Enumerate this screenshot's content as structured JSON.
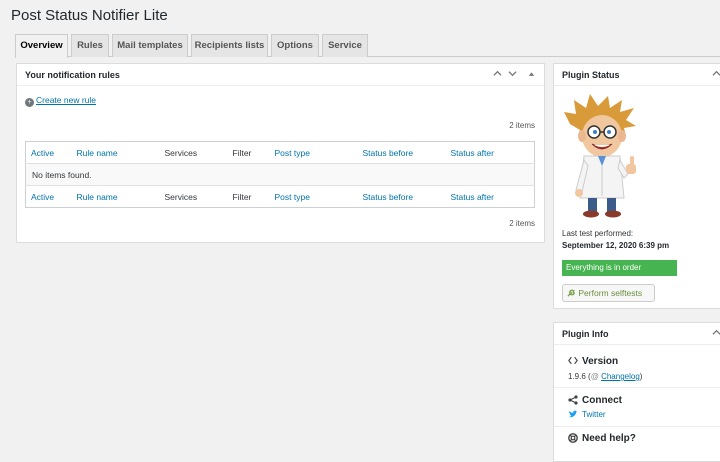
{
  "page": {
    "title": "Post Status Notifier Lite"
  },
  "tabs": [
    "Overview",
    "Rules",
    "Mail templates",
    "Recipients lists",
    "Options",
    "Service"
  ],
  "rules_box": {
    "title": "Your notification rules",
    "create_link": "Create new rule",
    "item_count": "2 items",
    "columns": [
      "Active",
      "Rule name",
      "Services",
      "Filter",
      "Post type",
      "Status before",
      "Status after"
    ],
    "empty_message": "No items found."
  },
  "status_box": {
    "title": "Plugin Status",
    "last_test_label": "Last test performed:",
    "last_test_date": "September 12, 2020 6:39 pm",
    "status_text": "Everything is in order",
    "selftest_button": "Perform selftests"
  },
  "info_box": {
    "title": "Plugin Info",
    "version_title": "Version",
    "version_number": "1.9.6",
    "changelog_prefix": "(",
    "changelog_link": "Changelog",
    "changelog_suffix": ")",
    "connect_title": "Connect",
    "twitter_link": "Twitter",
    "help_title": "Need help?"
  },
  "colors": {
    "accent": "#0073aa",
    "success": "#46b450",
    "background": "#f1f1f1"
  }
}
